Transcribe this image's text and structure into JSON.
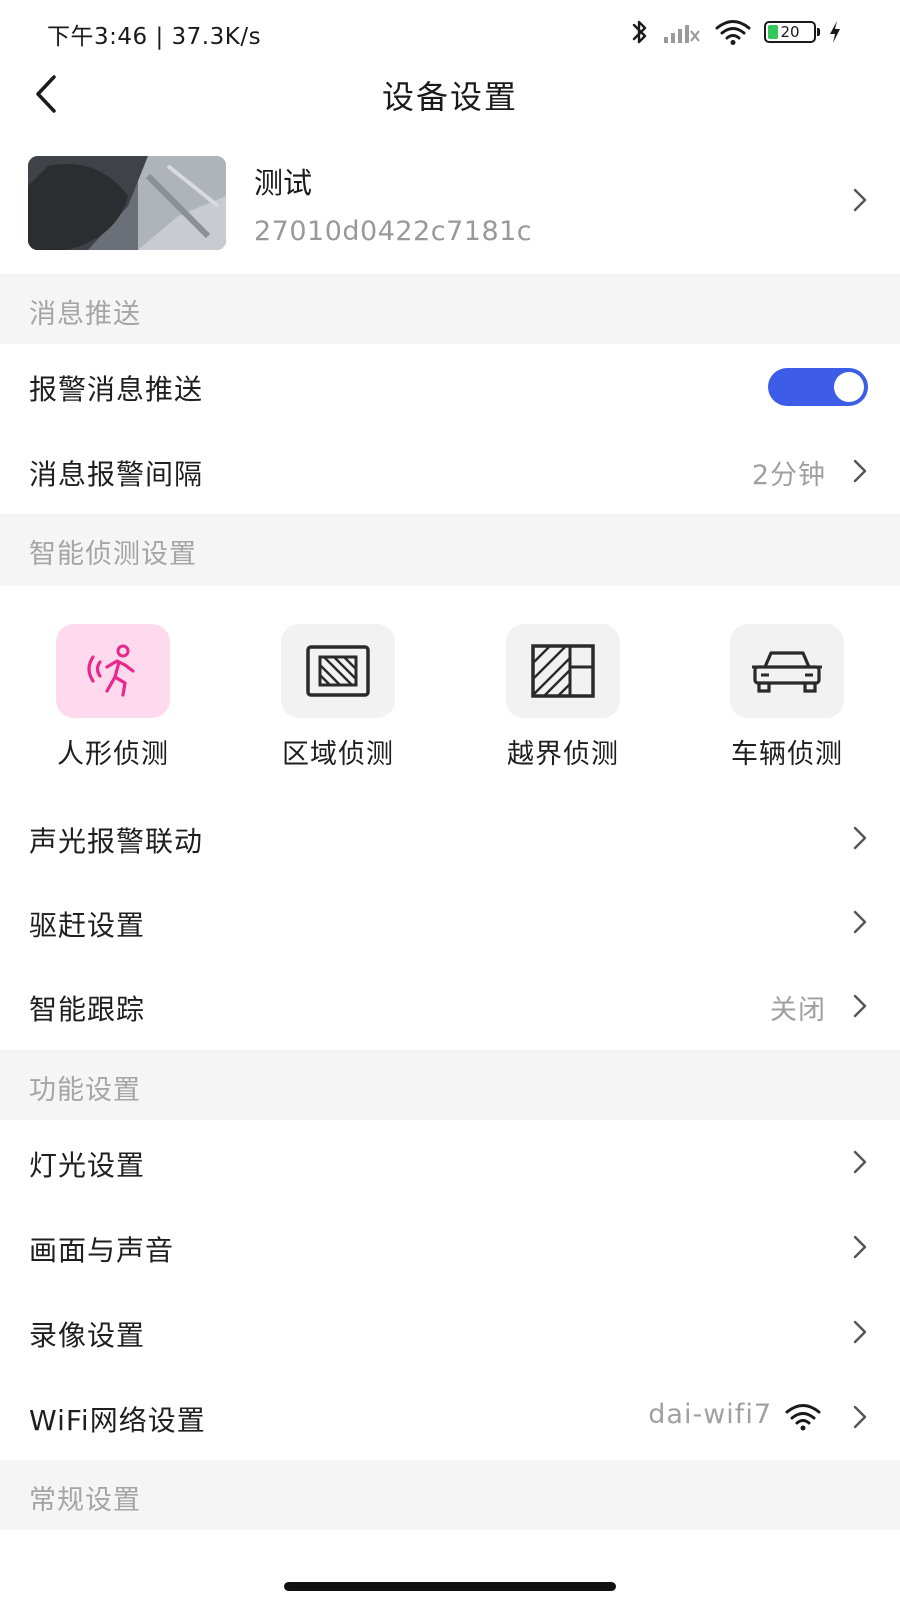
{
  "status_bar": {
    "time": "下午3:46 | 37.3K/s",
    "battery_level": "20",
    "battery_fraction": 0.2
  },
  "header": {
    "title": "设备设置",
    "back_icon": "chevron-left-icon"
  },
  "device": {
    "name": "测试",
    "id": "27010d0422c7181c"
  },
  "sections": {
    "message_push": "消息推送",
    "smart_detection": "智能侦测设置",
    "function": "功能设置",
    "general": "常规设置"
  },
  "message_rows": [
    {
      "label": "报警消息推送",
      "toggle_on": true
    },
    {
      "label": "消息报警间隔",
      "value": "2分钟"
    }
  ],
  "detection_items": [
    {
      "label": "人形侦测",
      "icon": "human-detection-icon",
      "active": true
    },
    {
      "label": "区域侦测",
      "icon": "area-detection-icon",
      "active": false
    },
    {
      "label": "越界侦测",
      "icon": "line-crossing-icon",
      "active": false
    },
    {
      "label": "车辆侦测",
      "icon": "vehicle-icon",
      "active": false
    }
  ],
  "smart_rows": [
    {
      "label": "声光报警联动"
    },
    {
      "label": "驱赶设置"
    },
    {
      "label": "智能跟踪",
      "value": "关闭"
    }
  ],
  "function_rows": [
    {
      "label": "灯光设置"
    },
    {
      "label": "画面与声音"
    },
    {
      "label": "录像设置"
    },
    {
      "label": "WiFi网络设置",
      "value": "dai-wifi7"
    }
  ],
  "colors": {
    "accent": "#3d5ce8",
    "active_detect_bg": "#ffd9ee",
    "active_detect_fg": "#e8288a",
    "section_bg": "#f5f5f5",
    "muted_text": "#a0a0a0"
  }
}
